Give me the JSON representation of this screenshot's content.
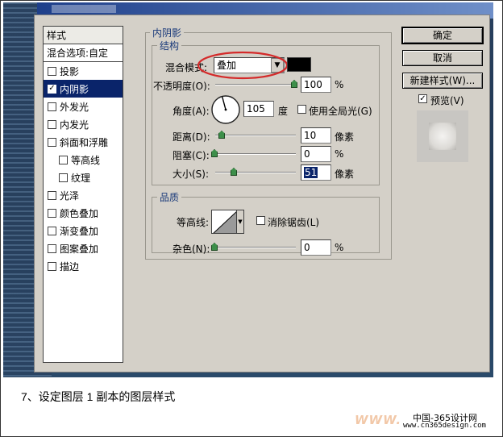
{
  "styles_panel": {
    "header": "样式",
    "blend_options": "混合选项:自定",
    "items": [
      {
        "label": "投影",
        "checked": false,
        "sub": false,
        "selected": false
      },
      {
        "label": "内阴影",
        "checked": true,
        "sub": false,
        "selected": true
      },
      {
        "label": "外发光",
        "checked": false,
        "sub": false,
        "selected": false
      },
      {
        "label": "内发光",
        "checked": false,
        "sub": false,
        "selected": false
      },
      {
        "label": "斜面和浮雕",
        "checked": false,
        "sub": false,
        "selected": false
      },
      {
        "label": "等高线",
        "checked": false,
        "sub": true,
        "selected": false
      },
      {
        "label": "纹理",
        "checked": false,
        "sub": true,
        "selected": false
      },
      {
        "label": "光泽",
        "checked": false,
        "sub": false,
        "selected": false
      },
      {
        "label": "颜色叠加",
        "checked": false,
        "sub": false,
        "selected": false
      },
      {
        "label": "渐变叠加",
        "checked": false,
        "sub": false,
        "selected": false
      },
      {
        "label": "图案叠加",
        "checked": false,
        "sub": false,
        "selected": false
      },
      {
        "label": "描边",
        "checked": false,
        "sub": false,
        "selected": false
      }
    ]
  },
  "inner_shadow": {
    "title": "内阴影",
    "structure": {
      "legend": "结构",
      "blend_mode_label": "混合模式:",
      "blend_mode_value": "叠加",
      "color_swatch": "#000000",
      "opacity_label": "不透明度(O):",
      "opacity_value": "100",
      "opacity_unit": "%",
      "angle_label": "角度(A):",
      "angle_value": "105",
      "angle_unit": "度",
      "global_light_label": "使用全局光(G)",
      "global_light_checked": false,
      "distance_label": "距离(D):",
      "distance_value": "10",
      "distance_unit": "像素",
      "choke_label": "阻塞(C):",
      "choke_value": "0",
      "choke_unit": "%",
      "size_label": "大小(S):",
      "size_value": "51",
      "size_unit": "像素"
    },
    "quality": {
      "legend": "品质",
      "contour_label": "等高线:",
      "antialias_label": "消除锯齿(L)",
      "antialias_checked": false,
      "noise_label": "杂色(N):",
      "noise_value": "0",
      "noise_unit": "%"
    }
  },
  "buttons": {
    "ok": "确定",
    "cancel": "取消",
    "new_style": "新建样式(W)...",
    "preview_label": "预览(V)",
    "preview_checked": true
  },
  "caption": "7、设定图层 1 副本的图层样式",
  "brand": {
    "name": "中国-365设计网",
    "url": "www.cn365design.com",
    "watermark": "WWW."
  },
  "colors": {
    "highlight_ellipse": "#d42a2a",
    "selection": "#0a246a",
    "dialog_bg": "#d4d0c8"
  }
}
